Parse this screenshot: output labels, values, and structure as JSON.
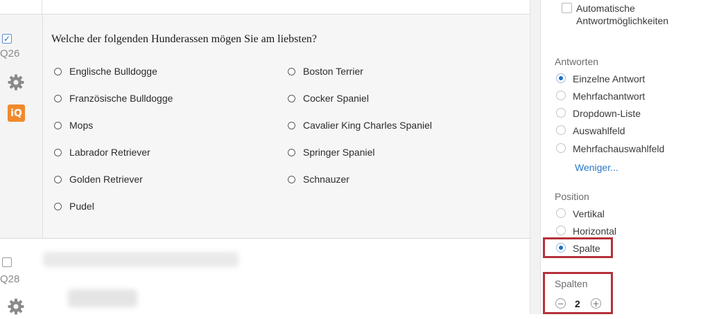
{
  "question": {
    "number": "Q26",
    "text": "Welche der folgenden Hunderassen mögen Sie am liebsten?",
    "choices_col1": [
      "Englische Bulldogge",
      "Französische Bulldogge",
      "Mops",
      "Labrador Retriever",
      "Golden Retriever",
      "Pudel"
    ],
    "choices_col2": [
      "Boston Terrier",
      "Cocker Spaniel",
      "Cavalier King Charles Spaniel",
      "Springer Spaniel",
      "Schnauzer"
    ]
  },
  "next_question": {
    "number": "Q28"
  },
  "icons": {
    "checkmark": "✓",
    "iq_label": "iQ",
    "minus": "−",
    "plus": "+"
  },
  "panel": {
    "auto_choices_line1": "Automatische",
    "auto_choices_line2": "Antwortmöglichkeiten",
    "answers": {
      "label": "Antworten",
      "options": [
        "Einzelne Antwort",
        "Mehrfachantwort",
        "Dropdown-Liste",
        "Auswahlfeld",
        "Mehrfachauswahlfeld"
      ],
      "selected": "Einzelne Antwort",
      "less_link": "Weniger..."
    },
    "position": {
      "label": "Position",
      "options": [
        "Vertikal",
        "Horizontal",
        "Spalte"
      ],
      "selected": "Spalte"
    },
    "columns": {
      "label": "Spalten",
      "value": "2"
    }
  },
  "colors": {
    "accent": "#1f6fbf",
    "highlight": "#b5313a",
    "iq_badge": "#f08a2c",
    "link": "#2a78c9"
  }
}
